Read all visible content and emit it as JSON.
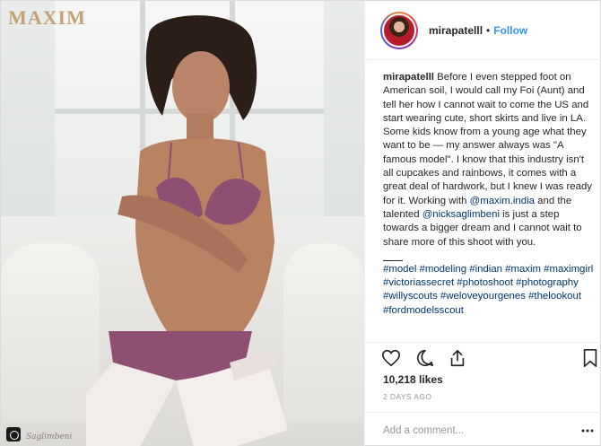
{
  "photo": {
    "brand": "MAXIM",
    "credit": "Saglimbeni"
  },
  "header": {
    "username": "mirapatelll",
    "separator": "•",
    "follow_label": "Follow"
  },
  "caption": {
    "username": "mirapatelll",
    "text_part1": " Before I even stepped foot on American soil, I would call my Foi (Aunt) and tell her how I cannot wait to come the US and start wearing cute, short skirts and live in LA. Some kids know from a young age what they want to be — my answer always was \"A famous model\". I know that this industry isn't all cupcakes and rainbows, it comes with a great deal of hardwork, but I knew I was ready for it. Working with ",
    "mention1": "@maxim.india",
    "text_part2": " and the talented ",
    "mention2": "@nicksaglimbeni",
    "text_part3": " is just a step towards a bigger dream and I cannot wait to share more of this shoot with you.",
    "hashtags": "#model #modeling #indian #maxim #maximgirl #victoriassecret #photoshoot #photography #willyscouts #weloveyourgenes #thelookout #fordmodelsscout"
  },
  "actions": {
    "like_icon": "heart-icon",
    "comment_icon": "comment-icon",
    "share_icon": "share-icon",
    "save_icon": "bookmark-icon"
  },
  "likes": "10,218 likes",
  "timestamp": "2 DAYS AGO",
  "comment": {
    "placeholder": "Add a comment..."
  },
  "colors": {
    "link": "#3897f0",
    "mention": "#003569",
    "muted": "#999999",
    "text": "#262626",
    "brand": "#c4a276"
  }
}
